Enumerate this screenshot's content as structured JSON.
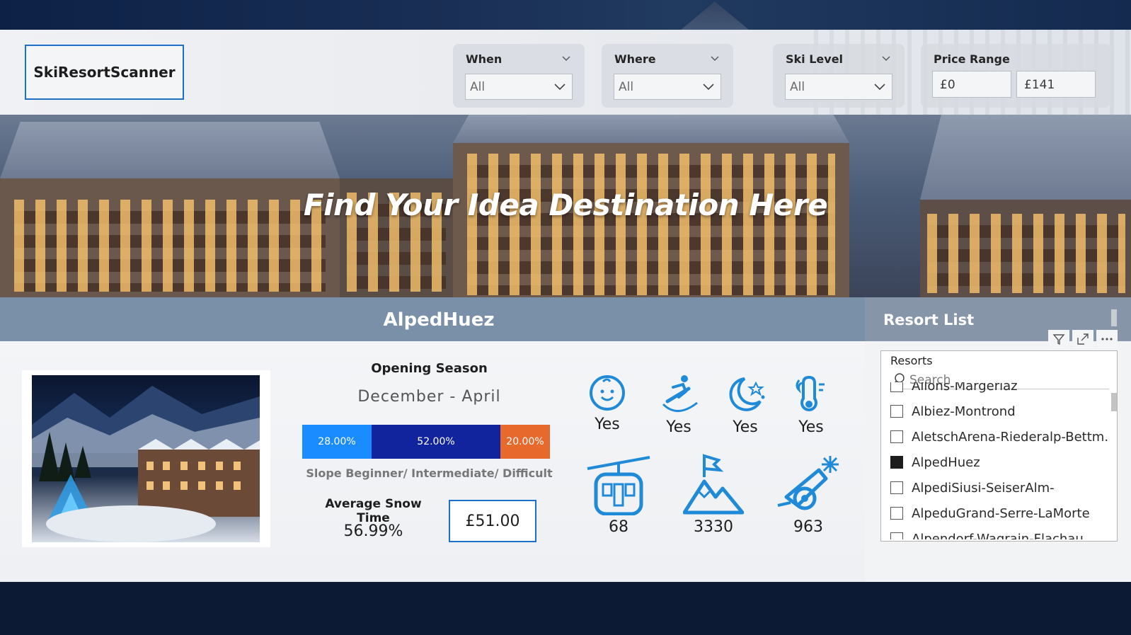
{
  "app": {
    "brand": "SkiResortScanner"
  },
  "filters": {
    "when": {
      "label": "When",
      "value": "All"
    },
    "where": {
      "label": "Where",
      "value": "All"
    },
    "ski_level": {
      "label": "Ski Level",
      "value": "All"
    },
    "price_range": {
      "label": "Price Range",
      "min": "£0",
      "max": "£141"
    }
  },
  "hero": {
    "title": "Find Your Idea Destination Here"
  },
  "resort": {
    "name": "AlpedHuez",
    "opening_season_label": "Opening Season",
    "opening_season": "December - April",
    "slopes": [
      {
        "level": "Beginner",
        "share": "28.00%",
        "percent": 28,
        "color": "#1a8cff"
      },
      {
        "level": "Intermediate",
        "share": "52.00%",
        "percent": 52,
        "color": "#11249e"
      },
      {
        "level": "Difficult",
        "share": "20.00%",
        "percent": 20,
        "color": "#e8692c"
      }
    ],
    "slope_caption": "Slope Beginner/ Intermediate/ Difficult",
    "snow_label": "Average Snow Time",
    "snow_value": "56.99%",
    "price": "£51.00",
    "features": [
      {
        "icon": "child-friendly-icon",
        "value": "Yes"
      },
      {
        "icon": "snowboard-icon",
        "value": "Yes"
      },
      {
        "icon": "night-ski-icon",
        "value": "Yes"
      },
      {
        "icon": "summer-ski-icon",
        "value": "Yes"
      },
      {
        "icon": "gondola-lift-icon",
        "value": "68"
      },
      {
        "icon": "mountain-peak-icon",
        "value": "3330"
      },
      {
        "icon": "snow-cannon-icon",
        "value": "963"
      }
    ],
    "icon_color": "#1f8ad8"
  },
  "resort_list": {
    "title": "Resort List",
    "field_label": "Resorts",
    "search_placeholder": "Search",
    "items": [
      {
        "name": "Allons-Margeriaz",
        "checked": false
      },
      {
        "name": "Albiez-Montrond",
        "checked": false
      },
      {
        "name": "AletschArena-Riederalp-Bettm...",
        "checked": false
      },
      {
        "name": "AlpedHuez",
        "checked": true
      },
      {
        "name": "AlpediSiusi-SeiserAlm-",
        "checked": false
      },
      {
        "name": "AlpeduGrand-Serre-LaMorte",
        "checked": false
      },
      {
        "name": "Alpendorf-Wagrain-Flachau",
        "checked": false
      }
    ]
  }
}
